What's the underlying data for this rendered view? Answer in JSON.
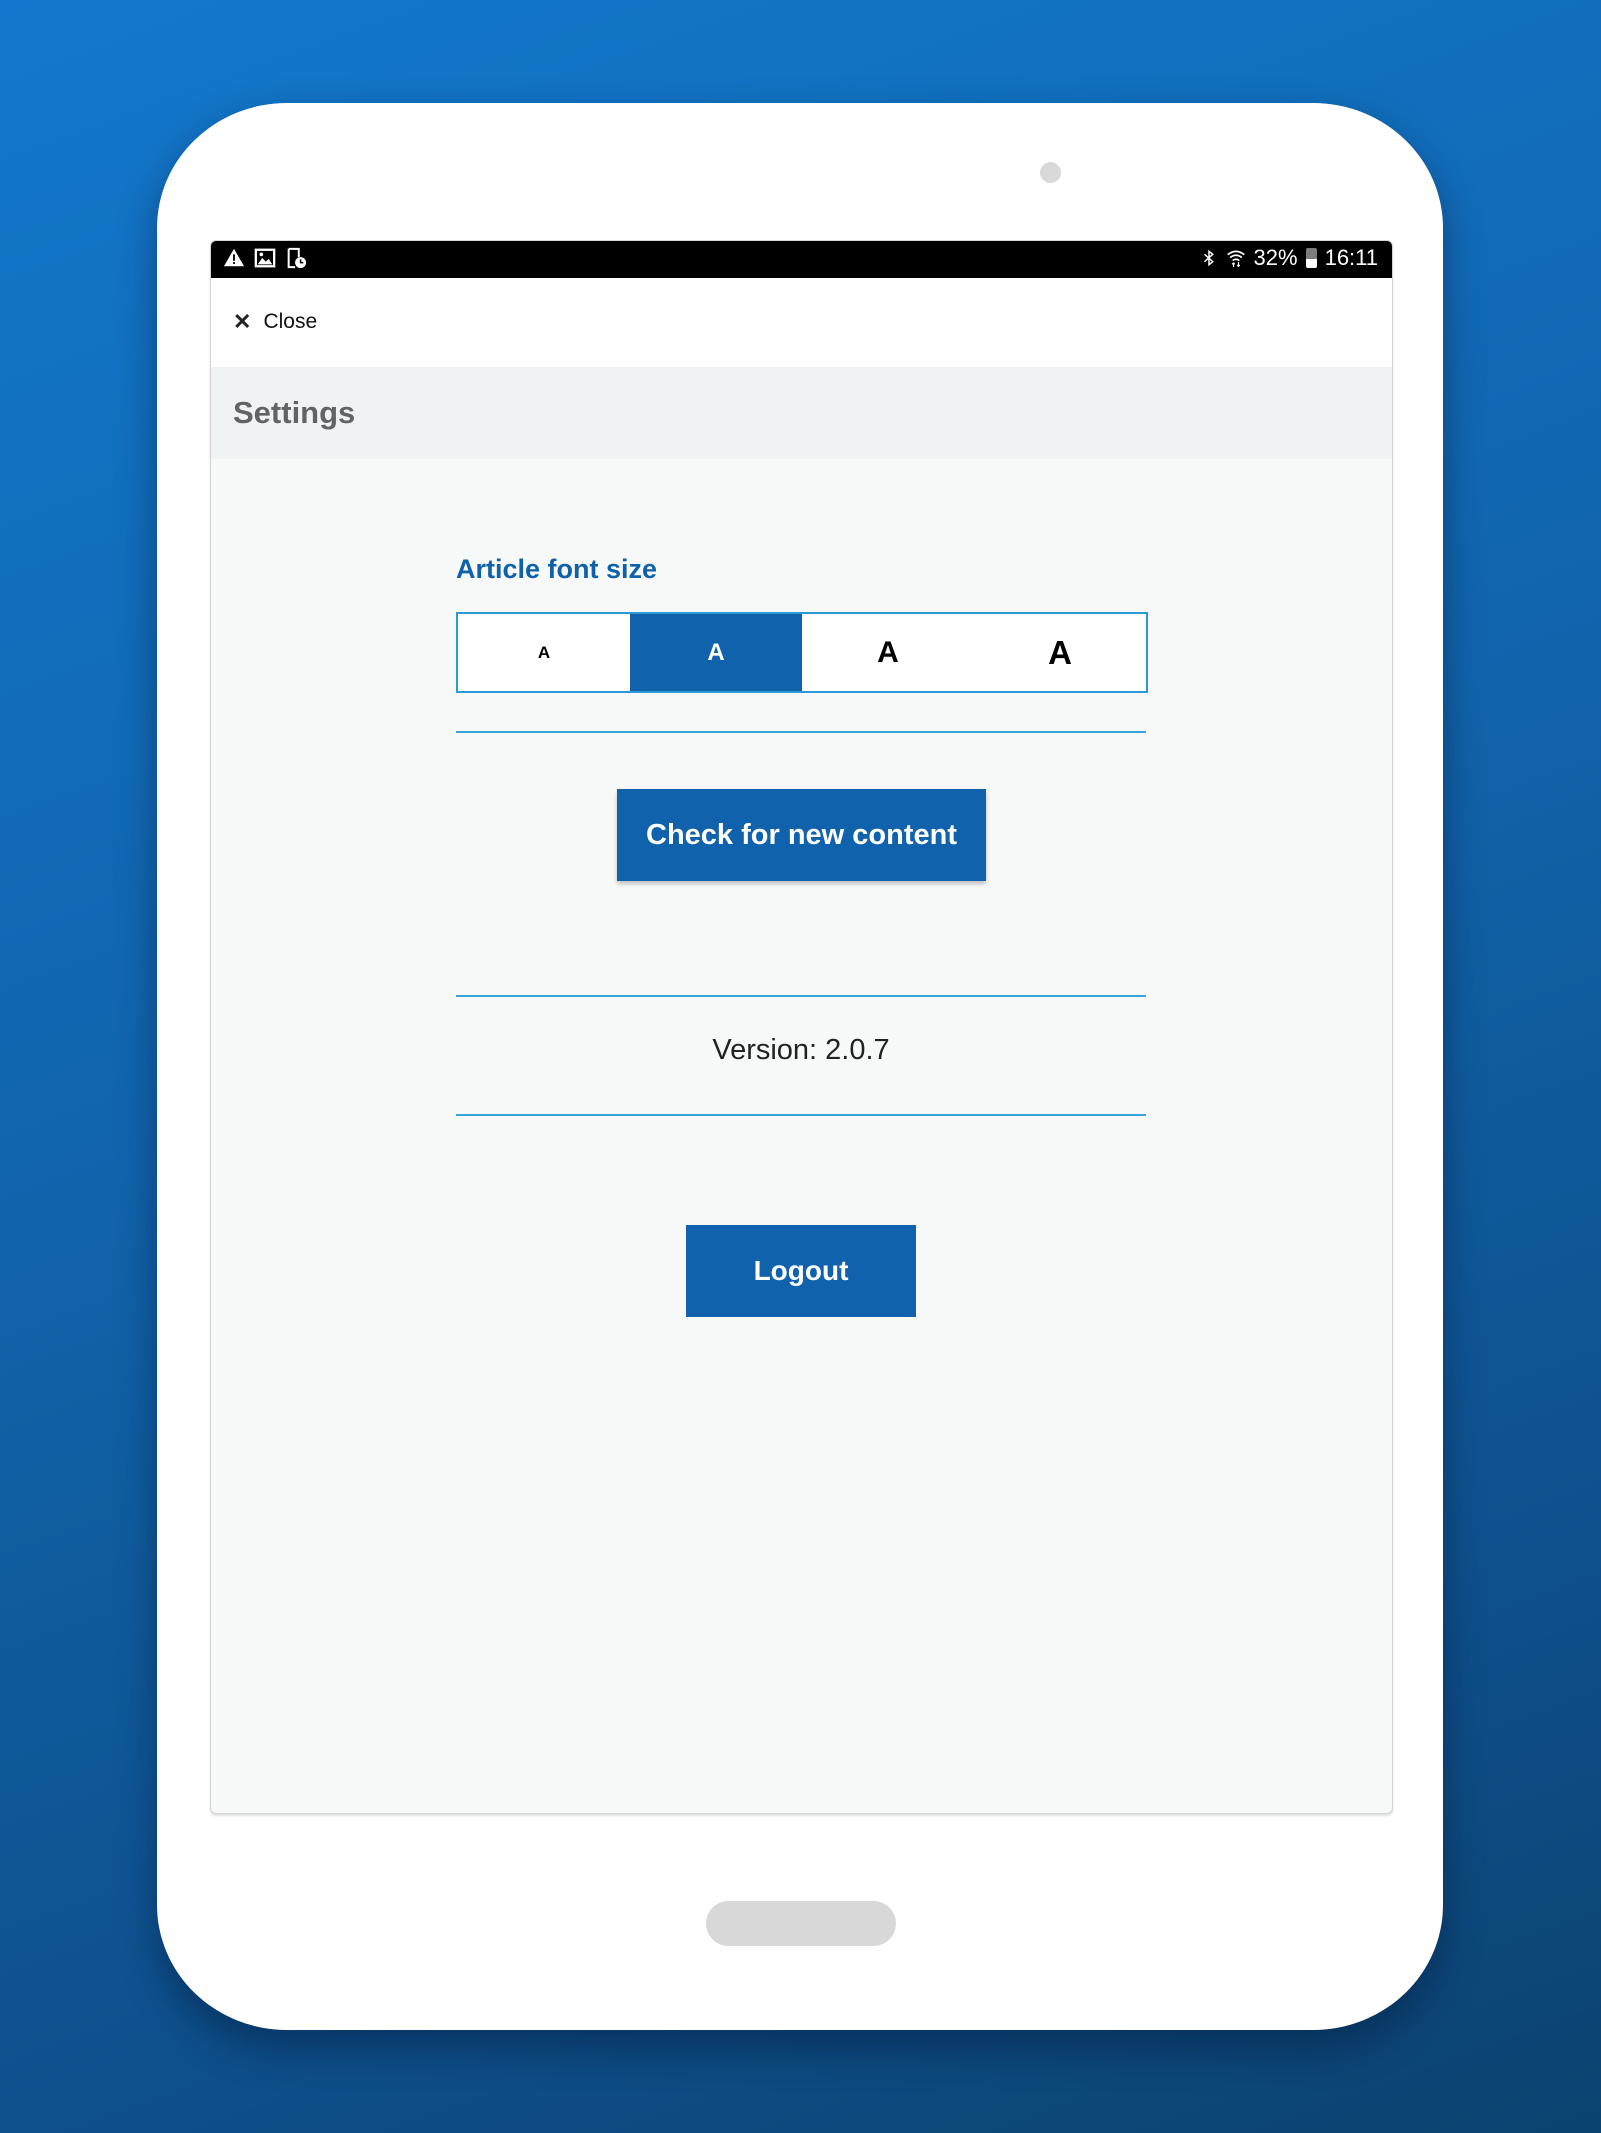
{
  "device": {
    "type": "tablet-frame",
    "colors": {
      "background_gradient": [
        "#1378cd",
        "#0c426f"
      ],
      "frame": "#ffffff",
      "home_button": "#d8d8d8"
    }
  },
  "status_bar": {
    "left_icons": [
      "warning-icon",
      "image-icon",
      "screen-timer-icon"
    ],
    "right_icons": [
      "bluetooth-icon",
      "wifi-icon",
      "battery-icon"
    ],
    "battery_percent": "32%",
    "battery_level": 0.32,
    "time": "16:11"
  },
  "header": {
    "close_icon": "close-icon",
    "close_label": "Close"
  },
  "page": {
    "title": "Settings"
  },
  "font_size": {
    "label": "Article font size",
    "options": [
      {
        "label": "A",
        "size": "small",
        "selected": false
      },
      {
        "label": "A",
        "size": "medium",
        "selected": true
      },
      {
        "label": "A",
        "size": "large",
        "selected": false
      },
      {
        "label": "A",
        "size": "extra-large",
        "selected": false
      }
    ]
  },
  "actions": {
    "check_label": "Check for new content",
    "logout_label": "Logout"
  },
  "version": {
    "text": "Version: 2.0.7"
  },
  "colors": {
    "accent": "#0f62ab",
    "divider": "#36a3dc",
    "title_gray": "#616467",
    "screen_bg": "#f7f9f9"
  }
}
